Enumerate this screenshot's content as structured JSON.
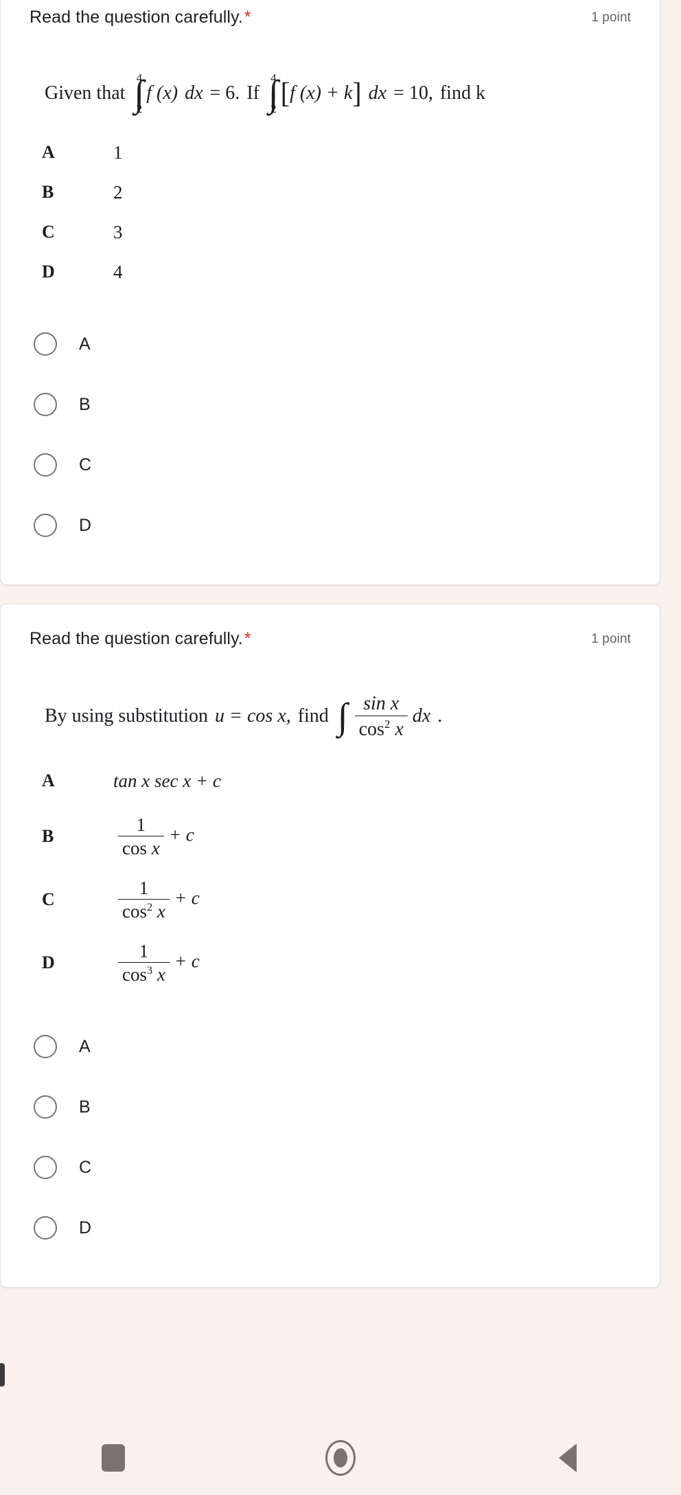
{
  "colors": {
    "page_background": "#faf1ec",
    "card_background": "#ffffff",
    "required_star": "#d93025",
    "points_text": "#5f6368",
    "radio_outline": "#70757a",
    "nav_icon": "#78736e"
  },
  "questions": [
    {
      "title": "Read the question carefully.",
      "required_marker": "*",
      "points": "1 point",
      "stem": {
        "lead": "Given that",
        "integral_1": {
          "upper": "4",
          "lower": "2",
          "integrand": "f (x)",
          "differential": "dx"
        },
        "equals_1": "= 6.",
        "connector": "If",
        "integral_2": {
          "upper": "4",
          "lower": "2",
          "bracket_open": "[",
          "integrand": "f (x) + k",
          "bracket_close": "]",
          "differential": "dx"
        },
        "equals_2": "= 10,",
        "tail": "find k"
      },
      "image_options": [
        {
          "letter": "A",
          "text": "1"
        },
        {
          "letter": "B",
          "text": "2"
        },
        {
          "letter": "C",
          "text": "3"
        },
        {
          "letter": "D",
          "text": "4"
        }
      ],
      "radio_options": [
        "A",
        "B",
        "C",
        "D"
      ]
    },
    {
      "title": "Read the question carefully.",
      "required_marker": "*",
      "points": "1 point",
      "stem": {
        "lead": "By using substitution",
        "substitution": "u = cos x,",
        "connector": "find",
        "integral": {
          "numerator": "sin x",
          "denominator": "cos",
          "denominator_exp": "2",
          "denominator_var": "x",
          "differential": "dx"
        },
        "tail": "."
      },
      "image_options": [
        {
          "letter": "A",
          "kind": "plain",
          "text": "tan x sec x + c"
        },
        {
          "letter": "B",
          "kind": "fraction",
          "numerator": "1",
          "den_base": "cos",
          "den_exp": "",
          "den_var": "x",
          "suffix": "+ c"
        },
        {
          "letter": "C",
          "kind": "fraction",
          "numerator": "1",
          "den_base": "cos",
          "den_exp": "2",
          "den_var": "x",
          "suffix": "+ c"
        },
        {
          "letter": "D",
          "kind": "fraction",
          "numerator": "1",
          "den_base": "cos",
          "den_exp": "3",
          "den_var": "x",
          "suffix": "+ c"
        }
      ],
      "radio_options": [
        "A",
        "B",
        "C",
        "D"
      ]
    }
  ],
  "navbar": {
    "recents_label": "recents-square",
    "home_label": "home-circle",
    "back_label": "back-triangle"
  }
}
